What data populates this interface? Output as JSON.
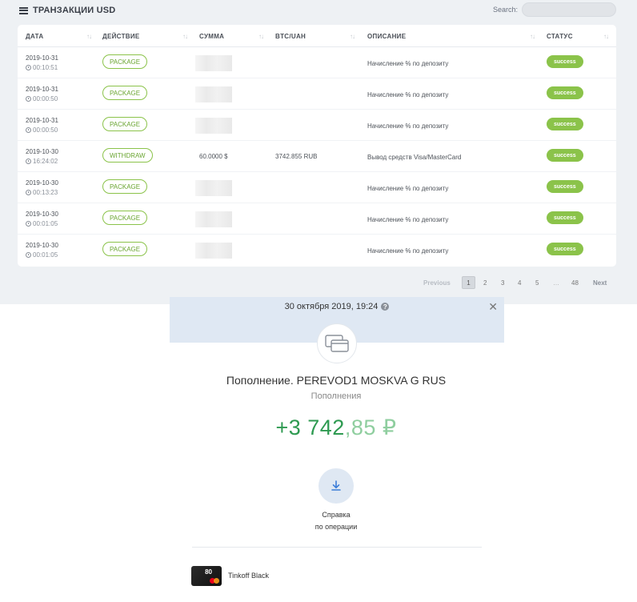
{
  "panel": {
    "title": "ТРАНЗАКЦИИ USD",
    "search_label": "Search:",
    "search_value": ""
  },
  "table": {
    "columns": [
      "ДАТА",
      "ДЕЙСТВИЕ",
      "СУММА",
      "BTC/UAH",
      "ОПИСАНИЕ",
      "СТАТУС"
    ],
    "rows": [
      {
        "date": "2019-10-31",
        "time": "00:10:51",
        "action": "PACKAGE",
        "amount": "",
        "btc": "",
        "desc": "Начисление % по депозиту",
        "status": "success"
      },
      {
        "date": "2019-10-31",
        "time": "00:00:50",
        "action": "PACKAGE",
        "amount": "",
        "btc": "",
        "desc": "Начисление % по депозиту",
        "status": "success"
      },
      {
        "date": "2019-10-31",
        "time": "00:00:50",
        "action": "PACKAGE",
        "amount": "",
        "btc": "",
        "desc": "Начисление % по депозиту",
        "status": "success"
      },
      {
        "date": "2019-10-30",
        "time": "16:24:02",
        "action": "WITHDRAW",
        "amount": "60.0000 $",
        "btc": "3742.855 RUB",
        "desc": "Вывод средств Visa/MasterCard",
        "status": "success"
      },
      {
        "date": "2019-10-30",
        "time": "00:13:23",
        "action": "PACKAGE",
        "amount": "",
        "btc": "",
        "desc": "Начисление % по депозиту",
        "status": "success"
      },
      {
        "date": "2019-10-30",
        "time": "00:01:05",
        "action": "PACKAGE",
        "amount": "",
        "btc": "",
        "desc": "Начисление % по депозиту",
        "status": "success"
      },
      {
        "date": "2019-10-30",
        "time": "00:01:05",
        "action": "PACKAGE",
        "amount": "",
        "btc": "",
        "desc": "Начисление % по депозиту",
        "status": "success"
      }
    ]
  },
  "pagination": {
    "previous": "Previous",
    "pages": [
      "1",
      "2",
      "3",
      "4",
      "5"
    ],
    "ellipsis": "…",
    "last": "48",
    "next": "Next",
    "current": "1"
  },
  "detail": {
    "datetime": "30 октября 2019, 19:24",
    "help_glyph": "?",
    "close_glyph": "✕",
    "title": "Пополнение. PEREVOD1 MOSKVA G RUS",
    "category": "Пополнения",
    "amount_int": "+3 742",
    "amount_dec": ",85 ₽",
    "ref_line1": "Справка",
    "ref_line2": "по операции",
    "card_number": "80",
    "card_name": "Tinkoff Black"
  },
  "colors": {
    "accent_green": "#8bc34a",
    "amount_green": "#2e9a51",
    "amount_green_light": "#8fce9f",
    "header_blue": "#dfe8f3",
    "download_blue": "#3b7dd8"
  },
  "icons": {
    "title": "table-icon",
    "time": "clock-icon",
    "help": "question-icon",
    "close": "close-icon",
    "operation": "cards-icon",
    "download": "download-icon",
    "card_brand": "mastercard-icon"
  }
}
